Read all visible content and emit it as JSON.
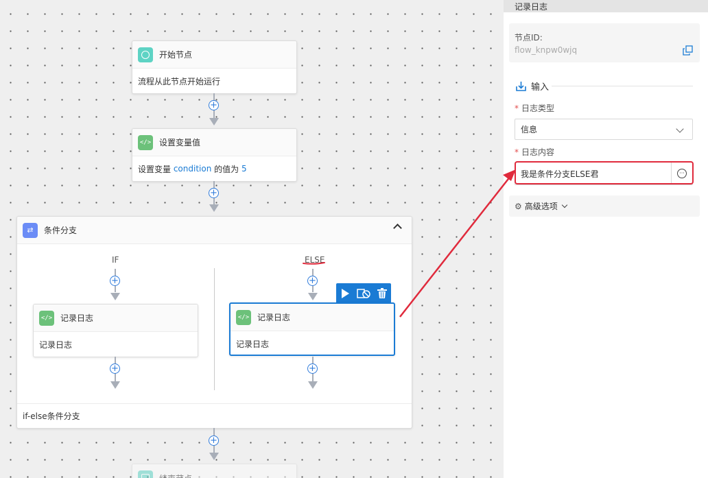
{
  "canvas": {
    "start_node": {
      "title": "开始节点",
      "body": "流程从此节点开始运行"
    },
    "set_var_node": {
      "title": "设置变量值",
      "body_prefix": "设置变量 ",
      "body_var": "condition",
      "body_mid": " 的值为 ",
      "body_val": "5"
    },
    "branch_node": {
      "title": "条件分支",
      "footer": "if-else条件分支",
      "if_label": "IF",
      "else_label": "ELSE",
      "if_log": {
        "title": "记录日志",
        "body": "记录日志"
      },
      "else_log": {
        "title": "记录日志",
        "body": "记录日志"
      }
    },
    "end_node": {
      "title": "结束节点"
    },
    "icons": {
      "code": "</>",
      "plus": "+",
      "chevron": "^"
    }
  },
  "toolbar": {
    "run_icon": "play-icon",
    "disable_icon": "disable-icon",
    "delete_icon": "trash-icon"
  },
  "panel": {
    "title": "记录日志",
    "node_id_label": "节点ID:",
    "node_id_value": "flow_knpw0wjq",
    "input_section": "输入",
    "log_type_label": "日志类型",
    "log_type_value": "信息",
    "log_content_label": "日志内容",
    "log_content_value": "我是条件分支ELSE君",
    "advanced_label": "高级选项",
    "required_mark": "*",
    "ellipsis": "···"
  },
  "colors": {
    "accent": "#1a7bd4",
    "annotation": "#e02a3c"
  }
}
